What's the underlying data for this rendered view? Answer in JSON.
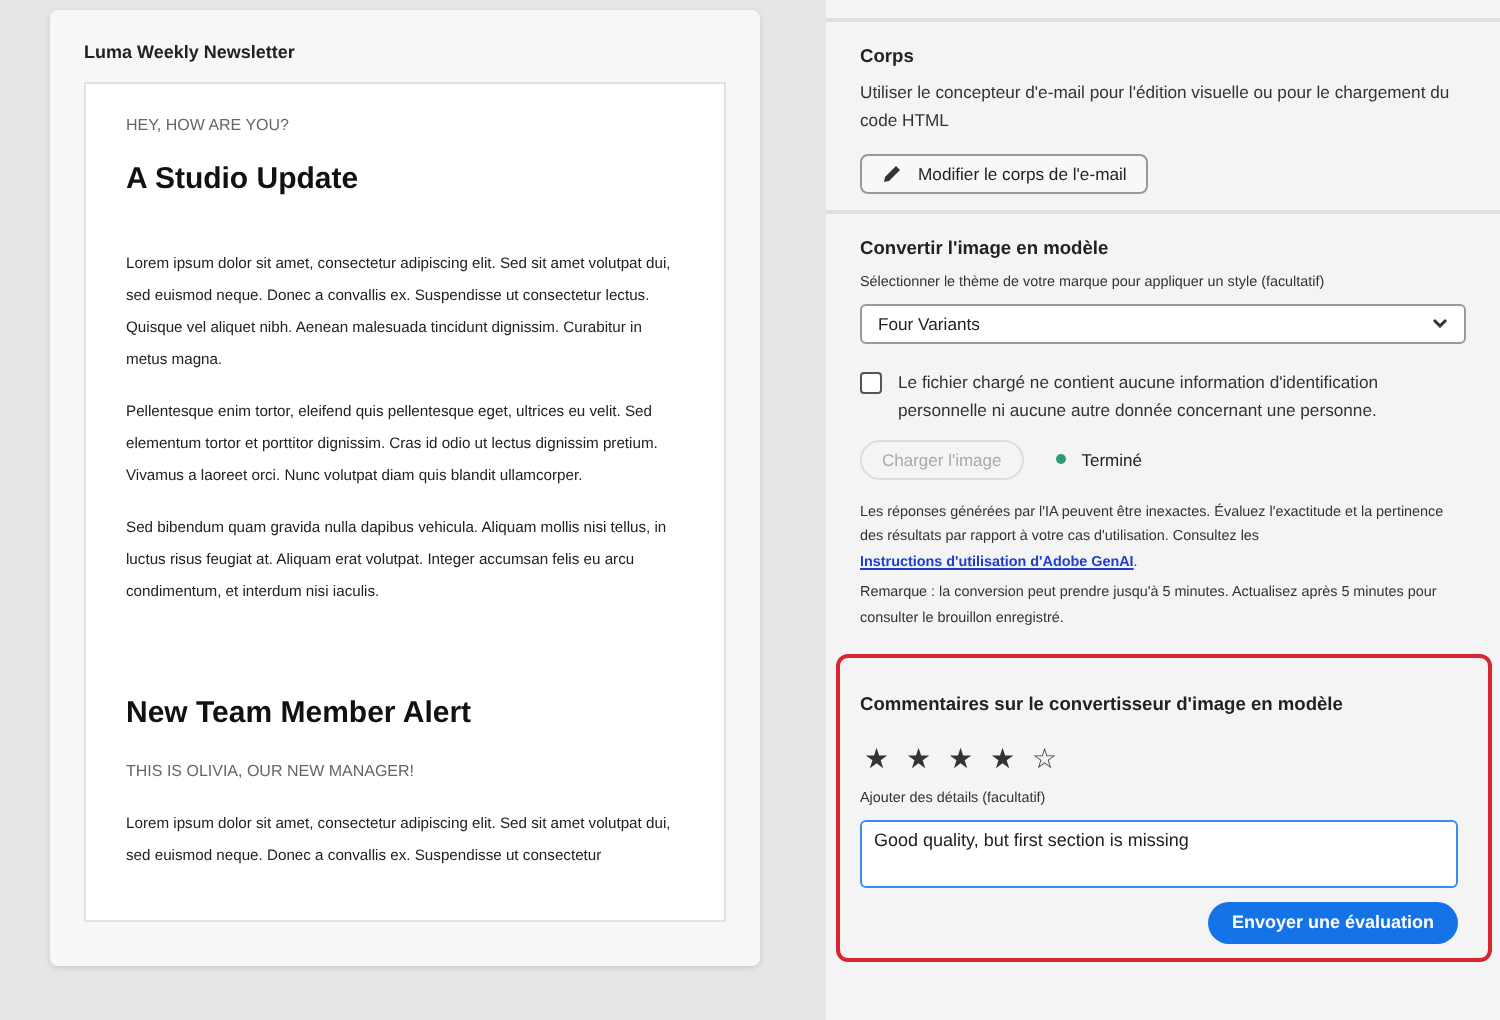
{
  "preview": {
    "title": "Luma Weekly Newsletter",
    "email": [
      {
        "kind": "eyebrow",
        "text": "HEY, HOW ARE YOU?"
      },
      {
        "kind": "heading",
        "text": "A Studio Update"
      },
      {
        "kind": "paragraph",
        "text": "Lorem ipsum dolor sit amet, consectetur adipiscing elit. Sed sit amet volutpat dui, sed euismod neque. Donec a convallis ex. Suspendisse ut consectetur lectus. Quisque vel aliquet nibh. Aenean malesuada tincidunt dignissim. Curabitur in metus magna."
      },
      {
        "kind": "paragraph",
        "text": "Pellentesque enim tortor, eleifend quis pellentesque eget, ultrices eu velit. Sed elementum tortor et porttitor dignissim. Cras id odio ut lectus dignissim pretium. Vivamus a laoreet orci. Nunc volutpat diam quis blandit ullamcorper."
      },
      {
        "kind": "paragraph",
        "text": "Sed bibendum quam gravida nulla dapibus vehicula. Aliquam mollis nisi tellus, in luctus risus feugiat at. Aliquam erat volutpat. Integer accumsan felis eu arcu condimentum, et interdum nisi iaculis."
      },
      {
        "kind": "heading",
        "text": "New Team Member Alert"
      },
      {
        "kind": "eyebrow",
        "text": "THIS IS OLIVIA, OUR NEW MANAGER!"
      },
      {
        "kind": "paragraph",
        "text": "Lorem ipsum dolor sit amet, consectetur adipiscing elit. Sed sit amet volutpat dui, sed euismod neque. Donec a convallis ex. Suspendisse ut consectetur"
      }
    ]
  },
  "body_section": {
    "title": "Corps",
    "description": "Utiliser le concepteur d'e-mail pour l'édition visuelle ou pour le chargement du code HTML",
    "button": "Modifier le corps de l'e-mail"
  },
  "convert_section": {
    "title": "Convertir l'image en modèle",
    "theme_label": "Sélectionner le thème de votre marque pour appliquer un style (facultatif)",
    "theme_value": "Four Variants",
    "consent": {
      "label": "Le fichier chargé ne contient aucune information d'identification personnelle ni aucune autre donnée concernant une personne.",
      "checked": false
    },
    "upload_button": {
      "label": "Charger l'image",
      "disabled": true
    },
    "status": {
      "label": "Terminé",
      "color": "#2d9d78"
    },
    "disclaimer": "Les réponses générées par l'IA peuvent être inexactes. Évaluez l'exactitude et la pertinence des résultats par rapport à votre cas d'utilisation. Consultez les ",
    "disclaimer_link": "Instructions d'utilisation d'Adobe GenAI",
    "disclaimer_end": ".",
    "note": "Remarque : la conversion peut prendre jusqu'à 5 minutes. Actualisez après 5 minutes pour consulter le brouillon enregistré."
  },
  "feedback": {
    "title": "Commentaires sur le convertisseur d'image en modèle",
    "stars": 4,
    "details_label": "Ajouter des détails (facultatif)",
    "details_value": "Good quality, but first section is missing",
    "submit": "Envoyer une évaluation"
  }
}
